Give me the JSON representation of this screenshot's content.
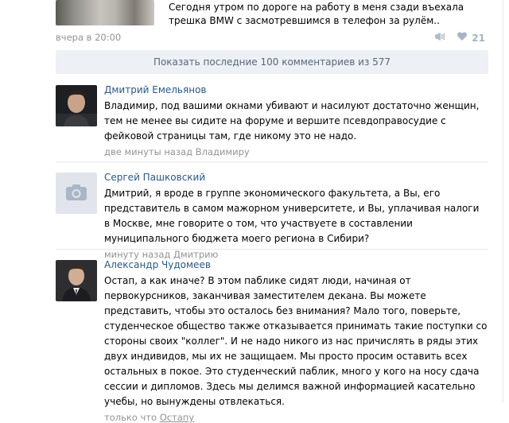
{
  "post": {
    "text": "Сегодня утром по дороге на работу в меня сзади въехала трешка BMW с засмотревшимся в телефон за рулём..",
    "time": "вчера в 20:00",
    "likes": "21"
  },
  "show_more": {
    "label": "Показать последние 100 комментариев из 577"
  },
  "comments": [
    {
      "author": "Дмитрий Емельянов",
      "text": "Владимир, под вашими окнами убивают и насилуют достаточно женщин, тем не менее вы сидите на форуме и вершите псевдоправосудие с фейковой страницы там, где никому это не надо.",
      "time": "две минуты назад",
      "reply_to": "Владимиру"
    },
    {
      "author": "Сергей Пашковский",
      "text": "Дмитрий, я вроде в группе экономического факультета, а Вы, его представитель в самом мажорном университете, и Вы, уплачивая налоги в Москве, мне говорите о том, что участвуете в составлении муниципального бюджета моего региона в Сибири?",
      "time": "минуту назад",
      "reply_to": "Дмитрию"
    },
    {
      "author": "Александр Чудомеев",
      "text": "Остап, а как иначе? В этом паблике сидят люди, начиная от первокурсников, заканчивая заместителем декана. Вы можете представить, чтобы это осталось без внимания? Мало того, поверьте, студенческое общество также отказывается принимать такие поступки со стороны своих \"коллег\". И не надо никого из нас причислять в ряды этих двух индивидов, мы их не защищаем. Мы просто просим оставить всех остальных в покое. Это студенческий паблик, много у кого на носу сдача сессии и дипломов. Здесь мы делимся важной информацией касательно учебы, но вынуждены отвлекаться.",
      "time": "только что",
      "reply_to": "Остапу"
    }
  ],
  "colors": {
    "link": "#2a5885",
    "meta": "#939393",
    "show_more_bg": "#edf0f5",
    "show_more_text": "#55677d"
  }
}
